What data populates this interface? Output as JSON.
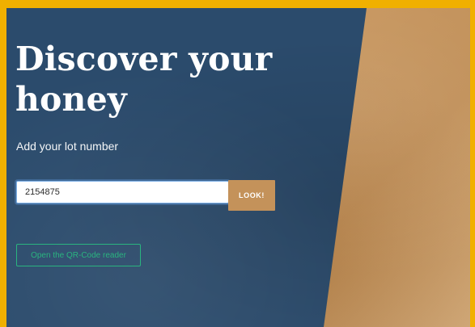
{
  "hero": {
    "title": "Discover your honey",
    "subtitle": "Add your lot number"
  },
  "lot_search": {
    "input_value": "2154875",
    "button_label": "LOOK!"
  },
  "qr": {
    "button_label": "Open the QR-Code reader"
  },
  "colors": {
    "panel": "#2b4b6c",
    "accent": "#c4925a",
    "qr_green": "#2ab47f",
    "frame": "#f0b000"
  }
}
